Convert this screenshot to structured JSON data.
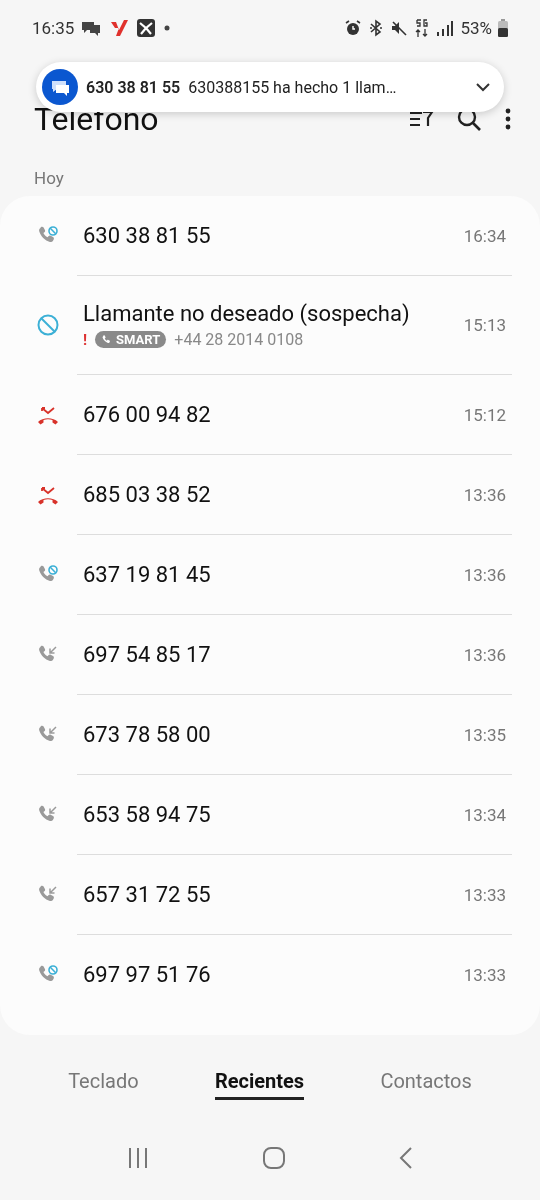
{
  "status_bar": {
    "time": "16:35",
    "battery": "53%"
  },
  "notification": {
    "title": "630 38 81 55",
    "text": "630388155 ha hecho 1 llam…"
  },
  "app_bar": {
    "title": "Teléfono"
  },
  "section": "Hoy",
  "calls": [
    {
      "kind": "blocked",
      "name": "630 38 81 55",
      "time": "16:34"
    },
    {
      "kind": "spam",
      "name": "Llamante no deseado (sospecha)",
      "warning": "!",
      "badge": "SMART",
      "number": "+44 28 2014 0108",
      "time": "15:13"
    },
    {
      "kind": "missed",
      "name": "676 00 94 82",
      "time": "15:12"
    },
    {
      "kind": "missed",
      "name": "685 03 38 52",
      "time": "13:36"
    },
    {
      "kind": "blocked",
      "name": "637 19 81 45",
      "time": "13:36"
    },
    {
      "kind": "incoming",
      "name": "697 54 85 17",
      "time": "13:36"
    },
    {
      "kind": "incoming",
      "name": "673 78 58 00",
      "time": "13:35"
    },
    {
      "kind": "incoming",
      "name": "653 58 94 75",
      "time": "13:34"
    },
    {
      "kind": "incoming",
      "name": "657 31 72 55",
      "time": "13:33"
    },
    {
      "kind": "blocked",
      "name": "697 97 51 76",
      "time": "13:33"
    }
  ],
  "tabs": [
    {
      "label": "Teclado",
      "selected": false
    },
    {
      "label": "Recientes",
      "selected": true
    },
    {
      "label": "Contactos",
      "selected": false
    }
  ]
}
